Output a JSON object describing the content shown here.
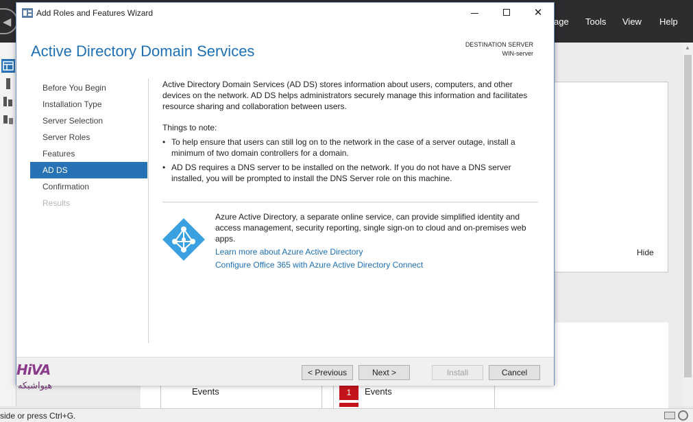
{
  "server_manager": {
    "menu": {
      "manage_partial": "age",
      "tools": "Tools",
      "view": "View",
      "help": "Help"
    },
    "hide_label": "Hide",
    "events_label_1": "Events",
    "events_label_2": "Events",
    "events_badge": "1",
    "status_text": "side or press Ctrl+G."
  },
  "wizard": {
    "window_title": "Add Roles and Features Wizard",
    "page_title": "Active Directory Domain Services",
    "destination_label": "DESTINATION SERVER",
    "destination_server": "WIN-server",
    "steps": [
      {
        "label": "Before You Begin",
        "state": "normal"
      },
      {
        "label": "Installation Type",
        "state": "normal"
      },
      {
        "label": "Server Selection",
        "state": "normal"
      },
      {
        "label": "Server Roles",
        "state": "normal"
      },
      {
        "label": "Features",
        "state": "normal"
      },
      {
        "label": "AD DS",
        "state": "active"
      },
      {
        "label": "Confirmation",
        "state": "normal"
      },
      {
        "label": "Results",
        "state": "disabled"
      }
    ],
    "intro": "Active Directory Domain Services (AD DS) stores information about users, computers, and other devices on the network.  AD DS helps administrators securely manage this information and facilitates resource sharing and collaboration between users.",
    "notes_heading": "Things to note:",
    "notes": [
      "To help ensure that users can still log on to the network in the case of a server outage, install a minimum of two domain controllers for a domain.",
      "AD DS requires a DNS server to be installed on the network.  If you do not have a DNS server installed, you will be prompted to install the DNS Server role on this machine."
    ],
    "azure_text": "Azure Active Directory, a separate online service, can provide simplified identity and access management, security reporting, single sign-on to cloud and on-premises web apps.",
    "azure_links": [
      "Learn more about Azure Active Directory",
      "Configure Office 365 with Azure Active Directory Connect"
    ],
    "buttons": {
      "previous": "< Previous",
      "next": "Next >",
      "install": "Install",
      "cancel": "Cancel"
    }
  },
  "watermark": {
    "brand_top": "HiVA",
    "brand_bottom": "هیواشبکه"
  },
  "colors": {
    "accent": "#2672b4",
    "title_blue": "#1f6fb3",
    "azure_icon": "#3aa0e0",
    "header_dark": "#2d2d30",
    "badge_red": "#c4141b"
  }
}
